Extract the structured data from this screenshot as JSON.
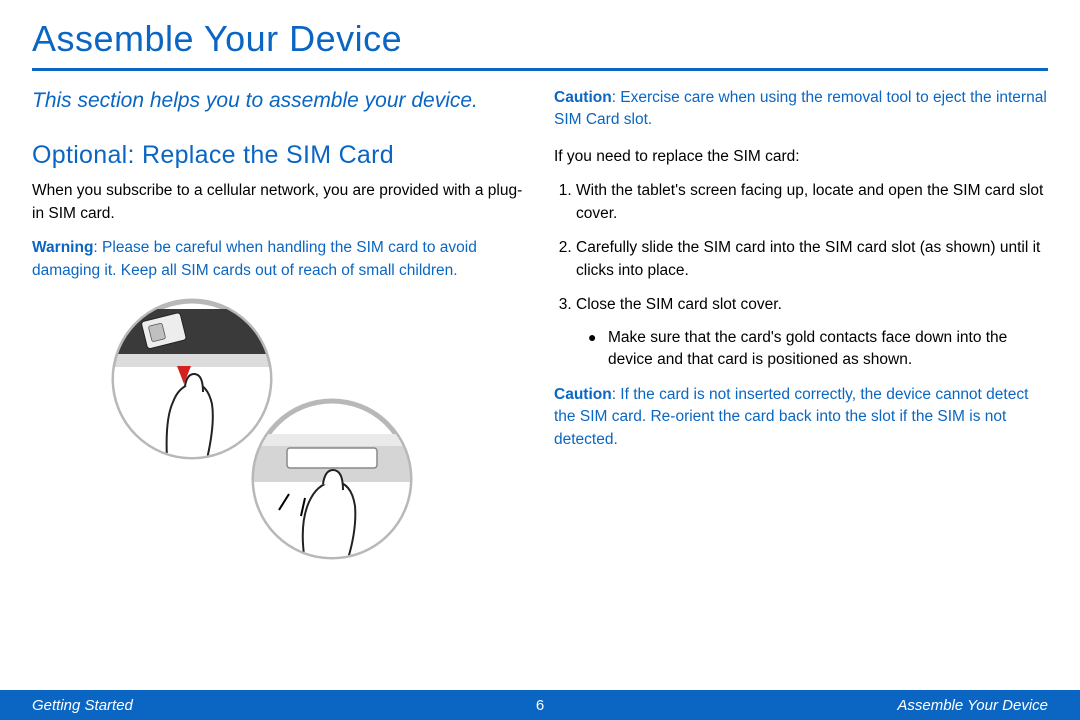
{
  "title": "Assemble Your Device",
  "intro": "This section helps you to assemble your device.",
  "h2": "Optional: Replace the SIM Card",
  "p_intro": "When you subscribe to a cellular network, you are provided with a plug-in SIM card.",
  "warning_label": "Warning",
  "warning_text": ": Please be careful when handling the SIM card to avoid damaging it. Keep all SIM cards out of reach of small children.",
  "caution1_label": "Caution",
  "caution1_text": ": Exercise care when using the removal tool to eject the internal SIM Card slot.",
  "need_replace": "If you need to replace the SIM card:",
  "step1": "With the tablet's screen facing up, locate and open the SIM card slot cover.",
  "step2": "Carefully slide the SIM card into the SIM card slot (as shown) until it clicks into place.",
  "step3": "Close the SIM card slot cover.",
  "bullet1": "Make sure that the card's gold contacts face down into the device and that card is positioned as shown.",
  "caution2_label": "Caution",
  "caution2_text": ": If the card is not inserted correctly, the device cannot detect the SIM card. Re-orient the card back into the slot if the SIM is not detected.",
  "footer_left": "Getting Started",
  "footer_page": "6",
  "footer_right": "Assemble Your Device"
}
